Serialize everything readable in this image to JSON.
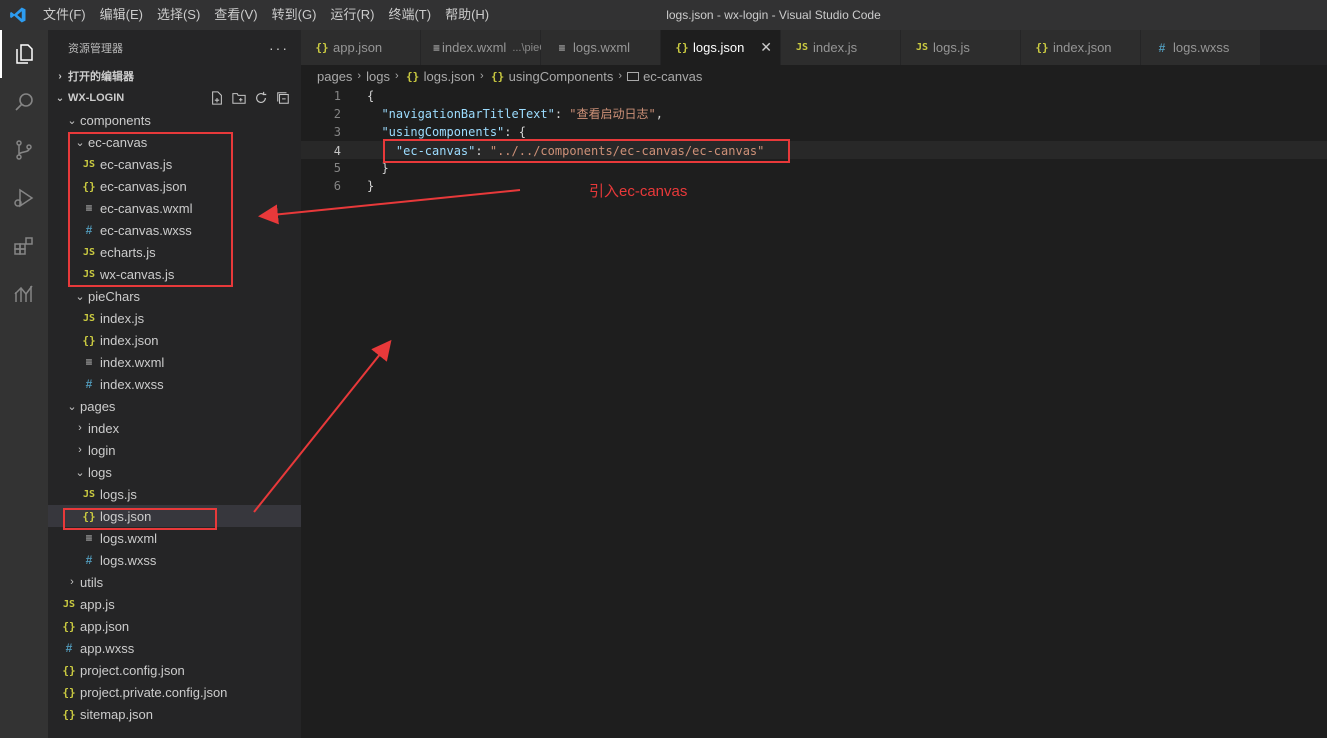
{
  "titlebar": {
    "menu": [
      "文件(F)",
      "编辑(E)",
      "选择(S)",
      "查看(V)",
      "转到(G)",
      "运行(R)",
      "终端(T)",
      "帮助(H)"
    ],
    "window_title": "logs.json - wx-login - Visual Studio Code"
  },
  "sidebar": {
    "header": "资源管理器",
    "open_editors": "打开的编辑器",
    "workspace": "WX-LOGIN",
    "tree": [
      {
        "label": "components",
        "type": "folder",
        "depth": 1,
        "open": true
      },
      {
        "label": "ec-canvas",
        "type": "folder",
        "depth": 2,
        "open": true
      },
      {
        "label": "ec-canvas.js",
        "type": "js",
        "depth": 3
      },
      {
        "label": "ec-canvas.json",
        "type": "json",
        "depth": 3
      },
      {
        "label": "ec-canvas.wxml",
        "type": "wxml",
        "depth": 3
      },
      {
        "label": "ec-canvas.wxss",
        "type": "wxss",
        "depth": 3
      },
      {
        "label": "echarts.js",
        "type": "js",
        "depth": 3
      },
      {
        "label": "wx-canvas.js",
        "type": "js",
        "depth": 3
      },
      {
        "label": "pieChars",
        "type": "folder",
        "depth": 2,
        "open": true
      },
      {
        "label": "index.js",
        "type": "js",
        "depth": 3
      },
      {
        "label": "index.json",
        "type": "json",
        "depth": 3
      },
      {
        "label": "index.wxml",
        "type": "wxml",
        "depth": 3
      },
      {
        "label": "index.wxss",
        "type": "wxss",
        "depth": 3
      },
      {
        "label": "pages",
        "type": "folder",
        "depth": 1,
        "open": true
      },
      {
        "label": "index",
        "type": "folder",
        "depth": 2,
        "open": false
      },
      {
        "label": "login",
        "type": "folder",
        "depth": 2,
        "open": false
      },
      {
        "label": "logs",
        "type": "folder",
        "depth": 2,
        "open": true
      },
      {
        "label": "logs.js",
        "type": "js",
        "depth": 3
      },
      {
        "label": "logs.json",
        "type": "json",
        "depth": 3,
        "selected": true
      },
      {
        "label": "logs.wxml",
        "type": "wxml",
        "depth": 3
      },
      {
        "label": "logs.wxss",
        "type": "wxss",
        "depth": 3
      },
      {
        "label": "utils",
        "type": "folder",
        "depth": 1,
        "open": false
      },
      {
        "label": "app.js",
        "type": "js",
        "depth": 0.5
      },
      {
        "label": "app.json",
        "type": "json",
        "depth": 0.5
      },
      {
        "label": "app.wxss",
        "type": "wxss",
        "depth": 0.5
      },
      {
        "label": "project.config.json",
        "type": "json",
        "depth": 0.5
      },
      {
        "label": "project.private.config.json",
        "type": "json",
        "depth": 0.5
      },
      {
        "label": "sitemap.json",
        "type": "json",
        "depth": 0.5
      }
    ]
  },
  "tabs": [
    {
      "label": "app.json",
      "type": "json"
    },
    {
      "label": "index.wxml",
      "type": "wxml",
      "desc": "...\\pieChars"
    },
    {
      "label": "logs.wxml",
      "type": "wxml"
    },
    {
      "label": "logs.json",
      "type": "json",
      "active": true
    },
    {
      "label": "index.js",
      "type": "js"
    },
    {
      "label": "logs.js",
      "type": "js"
    },
    {
      "label": "index.json",
      "type": "json"
    },
    {
      "label": "logs.wxss",
      "type": "wxss"
    }
  ],
  "breadcrumb": [
    "pages",
    "logs",
    "logs.json",
    "usingComponents",
    "ec-canvas"
  ],
  "editor": {
    "lines": [
      {
        "n": "1",
        "parts": [
          [
            "kk",
            "{"
          ]
        ]
      },
      {
        "n": "2",
        "parts": [
          [
            "kk",
            "  "
          ],
          [
            "k",
            "\"navigationBarTitleText\""
          ],
          [
            "kk",
            ": "
          ],
          [
            "s",
            "\"查看启动日志\""
          ],
          [
            "kk",
            ","
          ]
        ]
      },
      {
        "n": "3",
        "parts": [
          [
            "kk",
            "  "
          ],
          [
            "k",
            "\"usingComponents\""
          ],
          [
            "kk",
            ": {"
          ]
        ]
      },
      {
        "n": "4",
        "current": true,
        "parts": [
          [
            "kk",
            "    "
          ],
          [
            "k",
            "\"ec-canvas\""
          ],
          [
            "kk",
            ": "
          ],
          [
            "s",
            "\"../../components/ec-canvas/ec-canvas\""
          ]
        ]
      },
      {
        "n": "5",
        "parts": [
          [
            "kk",
            "  }"
          ]
        ]
      },
      {
        "n": "6",
        "parts": [
          [
            "kk",
            "}"
          ]
        ]
      }
    ]
  },
  "annotation": {
    "text": "引入ec-canvas",
    "color": "#e8393a"
  },
  "icons": {
    "activity": [
      "explorer-icon",
      "search-icon",
      "source-control-icon",
      "run-debug-icon",
      "extensions-icon",
      "analytics-icon"
    ],
    "sidebar_tools": [
      "new-file-icon",
      "new-folder-icon",
      "refresh-icon",
      "collapse-all-icon"
    ]
  }
}
